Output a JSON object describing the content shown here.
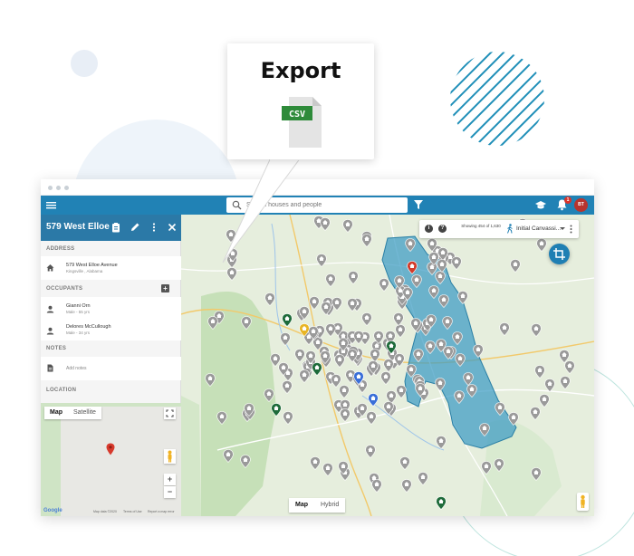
{
  "callout": {
    "title": "Export",
    "file_type": "CSV"
  },
  "header": {
    "search_placeholder": "Search houses and people",
    "notification_count": "1",
    "avatar_initials": "BT"
  },
  "panel": {
    "title": "579 West Elloe ...",
    "address_label": "ADDRESS",
    "address_line1": "579 West Elloe Avenue",
    "address_line2": "Kingsville , Alabama",
    "occupants_label": "OCCUPANTS",
    "occupants": [
      {
        "name": "Gianni Orn",
        "detail": "Male - 55 yrs"
      },
      {
        "name": "Delores McCullough",
        "detail": "Male - 34 yrs"
      }
    ],
    "notes_label": "NOTES",
    "add_note": "Add notes",
    "location_label": "LOCATION"
  },
  "minimap": {
    "map_label": "Map",
    "satellite_label": "Satellite",
    "zoom_in": "+",
    "zoom_out": "−",
    "google": "Google",
    "map_data": "Map data ©2020",
    "terms": "Terms of Use",
    "report": "Report a map error"
  },
  "map": {
    "info_icon": "i",
    "help_icon": "?",
    "showing_text": "Showing 454 of 1,630",
    "campaign": "Initial Canvassi...",
    "map_label": "Map",
    "hybrid_label": "Hybrid"
  },
  "colors": {
    "topbar": "#2182b5",
    "panel_header": "#2b79a7",
    "accent_teal": "#1f7fb3",
    "pin_gray": "#9a9a9a",
    "pin_green": "#1e6b3a",
    "pin_red": "#d23b2b",
    "pin_blue": "#3a6fd8",
    "pin_yellow": "#e8b525",
    "polygon_fill": "#3b9bc4"
  }
}
